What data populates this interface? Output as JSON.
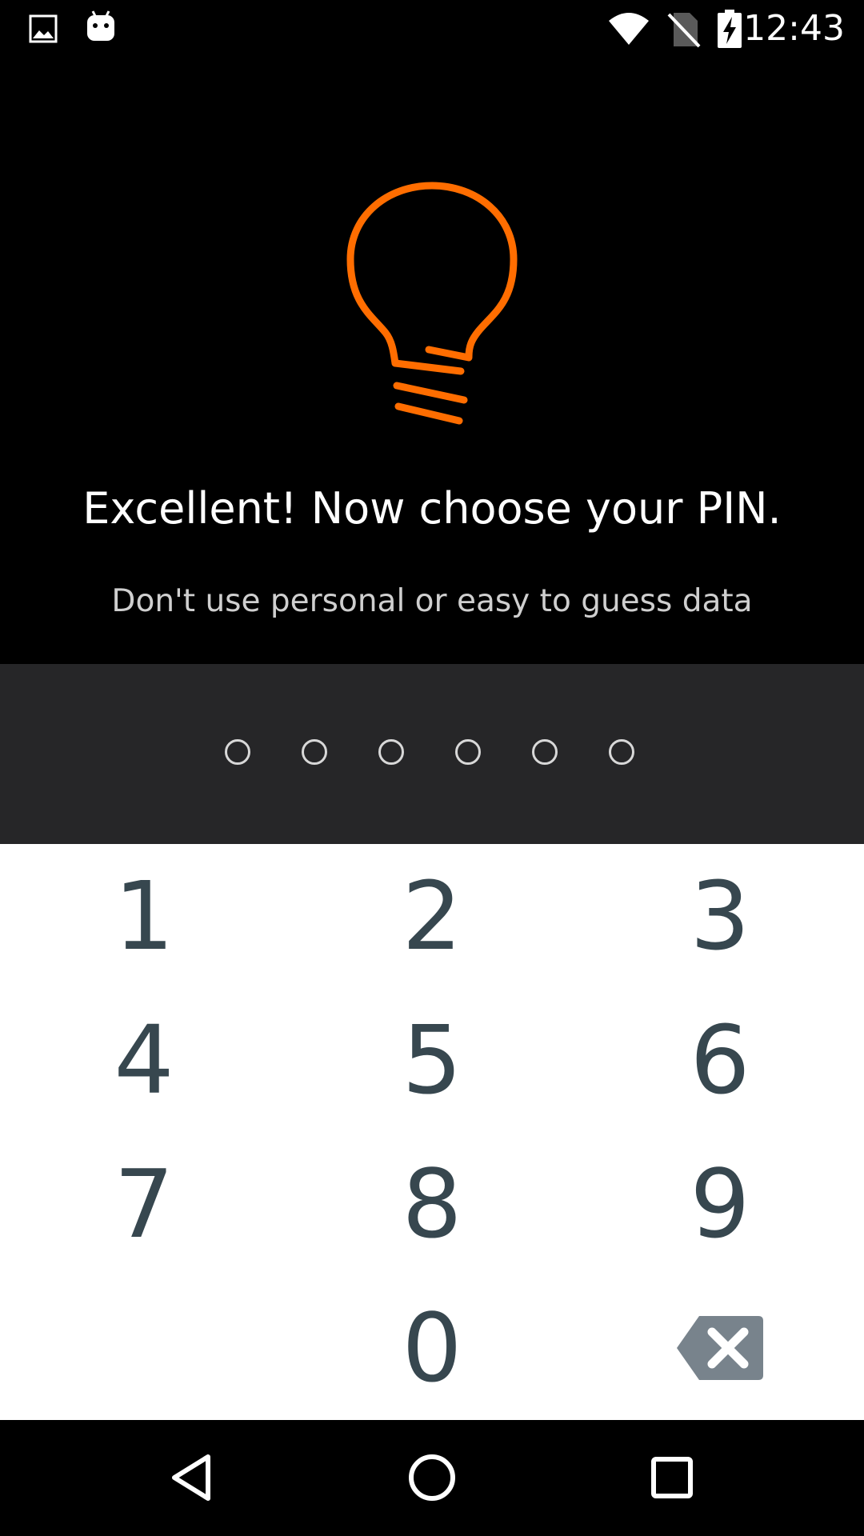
{
  "status_bar": {
    "time": "12:43",
    "icons": [
      "image-notification-icon",
      "android-notification-icon",
      "wifi-icon",
      "no-sim-icon",
      "battery-charging-icon"
    ]
  },
  "colors": {
    "accent": "#ff6d00",
    "key_text": "#37474f",
    "pin_strip_bg": "#262628",
    "backspace_bg": "#78838c"
  },
  "hero": {
    "icon": "lightbulb-icon",
    "headline": "Excellent! Now choose your PIN.",
    "subline": "Don't use personal or easy to guess data"
  },
  "pin": {
    "length": 6,
    "entered": 0
  },
  "keypad": {
    "keys": [
      "1",
      "2",
      "3",
      "4",
      "5",
      "6",
      "7",
      "8",
      "9",
      "",
      "0",
      "backspace"
    ]
  },
  "nav_bar": {
    "buttons": [
      "back-icon",
      "home-icon",
      "recents-icon"
    ]
  }
}
